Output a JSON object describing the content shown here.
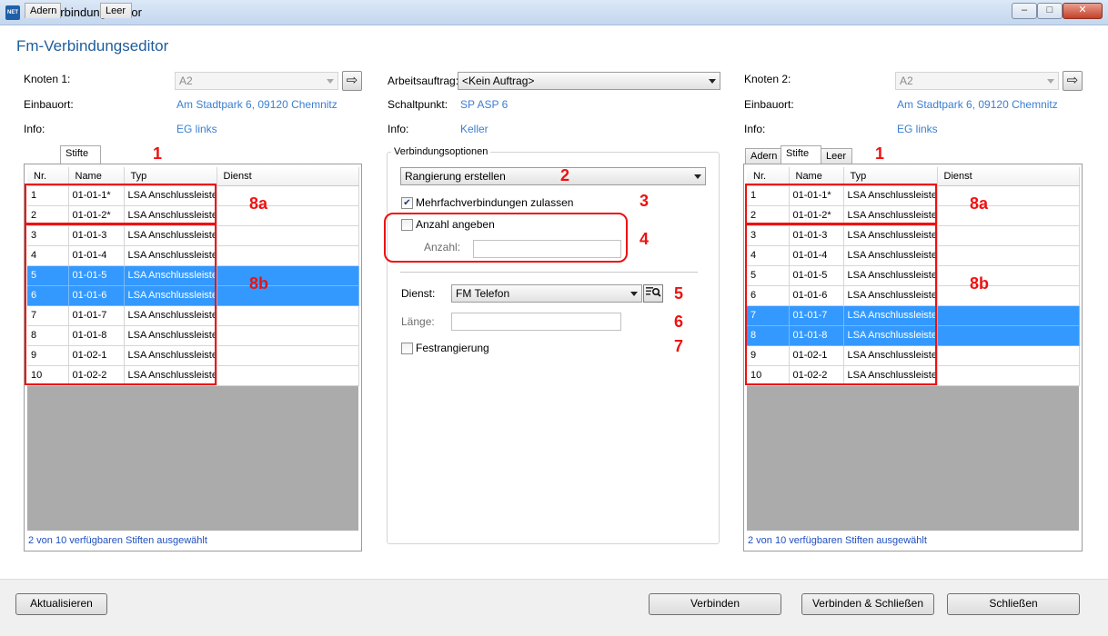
{
  "window": {
    "title": "Fm-Verbindungseditor",
    "icon_text": "NET",
    "minimize_glyph": "–",
    "maximize_glyph": "□",
    "close_glyph": "✕"
  },
  "heading": "Fm-Verbindungseditor",
  "left": {
    "knoten_label": "Knoten 1:",
    "knoten_value": "A2",
    "einbauort_label": "Einbauort:",
    "einbauort_value": "Am Stadtpark 6, 09120 Chemnitz",
    "info_label": "Info:",
    "info_value": "EG links",
    "tabs": [
      "Adern",
      "Stifte",
      "Leer"
    ],
    "active_tab": "Stifte",
    "columns": [
      "Nr.",
      "Name",
      "Typ",
      "Dienst"
    ],
    "rows": [
      {
        "nr": "1",
        "name": "01-01-1*",
        "typ": "LSA Anschlussleiste",
        "dienst": "",
        "selected": false
      },
      {
        "nr": "2",
        "name": "01-01-2*",
        "typ": "LSA Anschlussleiste",
        "dienst": "",
        "selected": false
      },
      {
        "nr": "3",
        "name": "01-01-3",
        "typ": "LSA Anschlussleiste",
        "dienst": "",
        "selected": false
      },
      {
        "nr": "4",
        "name": "01-01-4",
        "typ": "LSA Anschlussleiste",
        "dienst": "",
        "selected": false
      },
      {
        "nr": "5",
        "name": "01-01-5",
        "typ": "LSA Anschlussleiste",
        "dienst": "",
        "selected": true
      },
      {
        "nr": "6",
        "name": "01-01-6",
        "typ": "LSA Anschlussleiste",
        "dienst": "",
        "selected": true
      },
      {
        "nr": "7",
        "name": "01-01-7",
        "typ": "LSA Anschlussleiste",
        "dienst": "",
        "selected": false
      },
      {
        "nr": "8",
        "name": "01-01-8",
        "typ": "LSA Anschlussleiste",
        "dienst": "",
        "selected": false
      },
      {
        "nr": "9",
        "name": "01-02-1",
        "typ": "LSA Anschlussleiste",
        "dienst": "",
        "selected": false
      },
      {
        "nr": "10",
        "name": "01-02-2",
        "typ": "LSA Anschlussleiste",
        "dienst": "",
        "selected": false
      }
    ],
    "status": "2 von 10 verfügbaren Stiften ausgewählt"
  },
  "right": {
    "knoten_label": "Knoten 2:",
    "knoten_value": "A2",
    "einbauort_label": "Einbauort:",
    "einbauort_value": "Am Stadtpark 6, 09120 Chemnitz",
    "info_label": "Info:",
    "info_value": "EG links",
    "tabs": [
      "Adern",
      "Stifte",
      "Leer"
    ],
    "active_tab": "Stifte",
    "columns": [
      "Nr.",
      "Name",
      "Typ",
      "Dienst"
    ],
    "rows": [
      {
        "nr": "1",
        "name": "01-01-1*",
        "typ": "LSA Anschlussleiste",
        "dienst": "",
        "selected": false
      },
      {
        "nr": "2",
        "name": "01-01-2*",
        "typ": "LSA Anschlussleiste",
        "dienst": "",
        "selected": false
      },
      {
        "nr": "3",
        "name": "01-01-3",
        "typ": "LSA Anschlussleiste",
        "dienst": "",
        "selected": false
      },
      {
        "nr": "4",
        "name": "01-01-4",
        "typ": "LSA Anschlussleiste",
        "dienst": "",
        "selected": false
      },
      {
        "nr": "5",
        "name": "01-01-5",
        "typ": "LSA Anschlussleiste",
        "dienst": "",
        "selected": false
      },
      {
        "nr": "6",
        "name": "01-01-6",
        "typ": "LSA Anschlussleiste",
        "dienst": "",
        "selected": false
      },
      {
        "nr": "7",
        "name": "01-01-7",
        "typ": "LSA Anschlussleiste",
        "dienst": "",
        "selected": true
      },
      {
        "nr": "8",
        "name": "01-01-8",
        "typ": "LSA Anschlussleiste",
        "dienst": "",
        "selected": true
      },
      {
        "nr": "9",
        "name": "01-02-1",
        "typ": "LSA Anschlussleiste",
        "dienst": "",
        "selected": false
      },
      {
        "nr": "10",
        "name": "01-02-2",
        "typ": "LSA Anschlussleiste",
        "dienst": "",
        "selected": false
      }
    ],
    "status": "2 von 10 verfügbaren Stiften ausgewählt"
  },
  "center": {
    "arbeitsauftrag_label": "Arbeitsauftrag:",
    "arbeitsauftrag_value": "<Kein Auftrag>",
    "schaltpunkt_label": "Schaltpunkt:",
    "schaltpunkt_value": "SP ASP 6",
    "info_label": "Info:",
    "info_value": "Keller",
    "group_title": "Verbindungsoptionen",
    "mode_value": "Rangierung erstellen",
    "mehrfach_label": "Mehrfachverbindungen zulassen",
    "mehrfach_checked": true,
    "anzahl_angeben_label": "Anzahl angeben",
    "anzahl_angeben_checked": false,
    "anzahl_label": "Anzahl:",
    "anzahl_value": "",
    "dienst_label": "Dienst:",
    "dienst_value": "FM Telefon",
    "laenge_label": "Länge:",
    "laenge_value": "",
    "festrangierung_label": "Festrangierung",
    "festrangierung_checked": false
  },
  "annotations": {
    "n1": "1",
    "n2": "2",
    "n3": "3",
    "n4": "4",
    "n5": "5",
    "n6": "6",
    "n7": "7",
    "n8a": "8a",
    "n8b": "8b"
  },
  "footer": {
    "aktualisieren": "Aktualisieren",
    "verbinden": "Verbinden",
    "verbinden_schliessen": "Verbinden & Schließen",
    "schliessen": "Schließen"
  },
  "colors": {
    "selection": "#3399ff",
    "link": "#3b7fd0",
    "heading": "#1e5d9c",
    "annotation": "#ee1111",
    "grid_empty": "#ababab"
  }
}
